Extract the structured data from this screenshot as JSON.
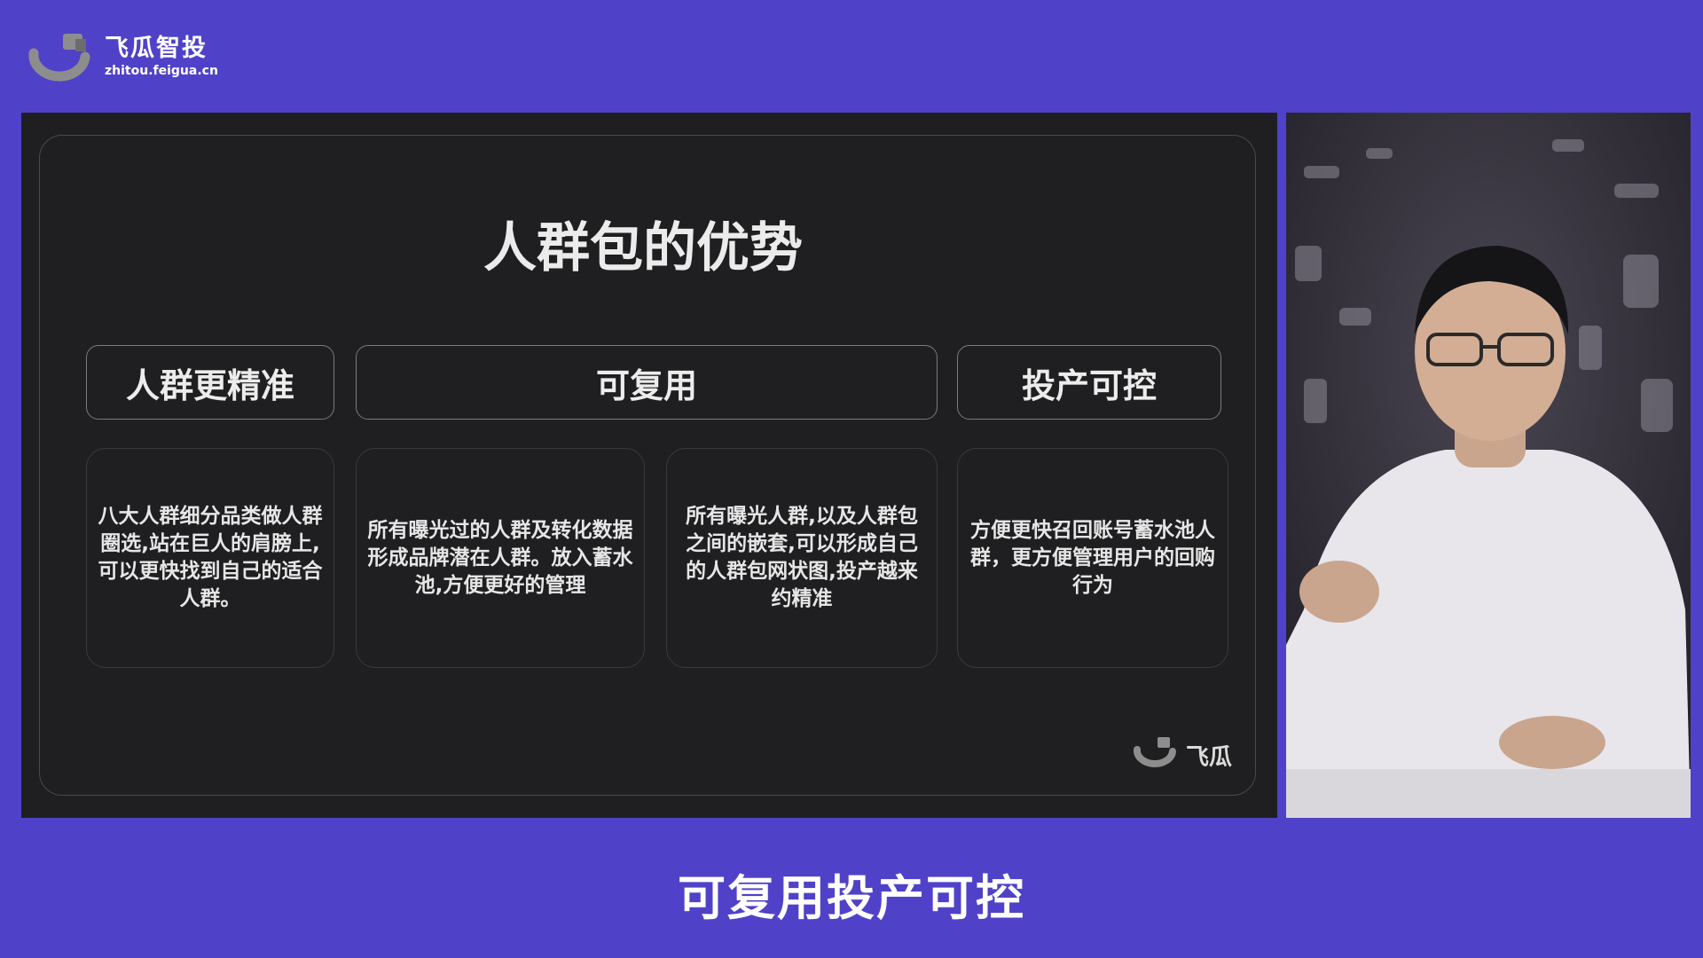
{
  "brand": {
    "name": "飞瓜智投",
    "url": "zhitou.feigua.cn"
  },
  "slide": {
    "title": "人群包的优势",
    "headers": [
      "人群更精准",
      "可复用",
      "投产可控"
    ],
    "descriptions": [
      "八大人群细分品类做人群圈选,站在巨人的肩膀上,可以更快找到自己的适合人群。",
      "所有曝光过的人群及转化数据形成品牌潜在人群。放入蓄水池,方便更好的管理",
      "所有曝光人群,以及人群包之间的嵌套,可以形成自己的人群包网状图,投产越来约精准",
      "方便更快召回账号蓄水池人群，更方便管理用户的回购行为"
    ],
    "corner_brand": "飞瓜"
  },
  "subtitle": "可复用投产可控",
  "colors": {
    "background": "#4f42c8",
    "slide": "#1f1f21",
    "logo_gray": "#8d8d8d"
  }
}
